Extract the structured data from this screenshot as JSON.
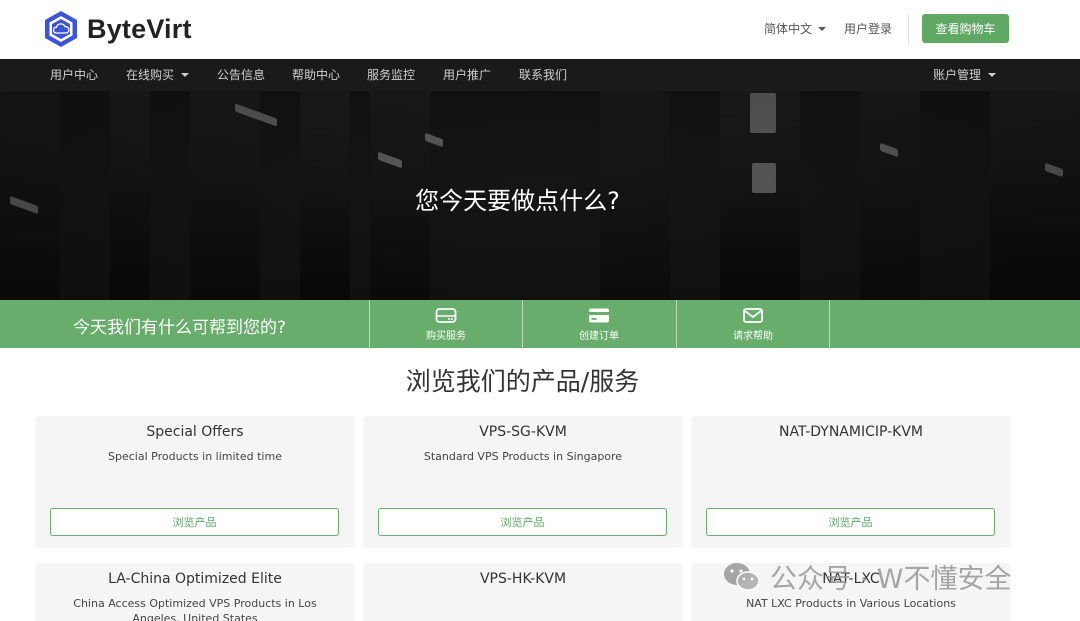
{
  "header": {
    "brand": "ByteVirt",
    "language": "简体中文",
    "login": "用户登录",
    "cart_button": "查看购物车"
  },
  "nav": {
    "items": [
      {
        "label": "用户中心"
      },
      {
        "label": "在线购买"
      },
      {
        "label": "公告信息"
      },
      {
        "label": "帮助中心"
      },
      {
        "label": "服务监控"
      },
      {
        "label": "用户推广"
      },
      {
        "label": "联系我们"
      }
    ],
    "account": "账户管理"
  },
  "hero": {
    "title": "您今天要做点什么?"
  },
  "strip": {
    "text": "今天我们有什么可帮到您的?",
    "actions": [
      {
        "label": "购买服务",
        "icon": "server-icon"
      },
      {
        "label": "创建订单",
        "icon": "credit-card-icon"
      },
      {
        "label": "请求帮助",
        "icon": "envelope-icon"
      }
    ]
  },
  "products": {
    "title": "浏览我们的产品/服务",
    "button_label": "浏览产品",
    "cards": [
      {
        "title": "Special Offers",
        "desc": "Special Products in limited time"
      },
      {
        "title": "VPS-SG-KVM",
        "desc": "Standard VPS Products in Singapore"
      },
      {
        "title": "NAT-DYNAMICIP-KVM",
        "desc": ""
      },
      {
        "title": "LA-China Optimized Elite",
        "desc": "China Access Optimized VPS Products in Los Angeles, United States"
      },
      {
        "title": "VPS-HK-KVM",
        "desc": ""
      },
      {
        "title": "NAT-LXC",
        "desc": "NAT LXC Products in Various Locations"
      }
    ]
  },
  "watermark": {
    "text": "公众号 · W不懂安全"
  },
  "colors": {
    "brand_green": "#5fa964",
    "strip_green": "#68ad6c",
    "nav_bg": "#1a1a1a",
    "logo_blue": "#3d55d4"
  }
}
